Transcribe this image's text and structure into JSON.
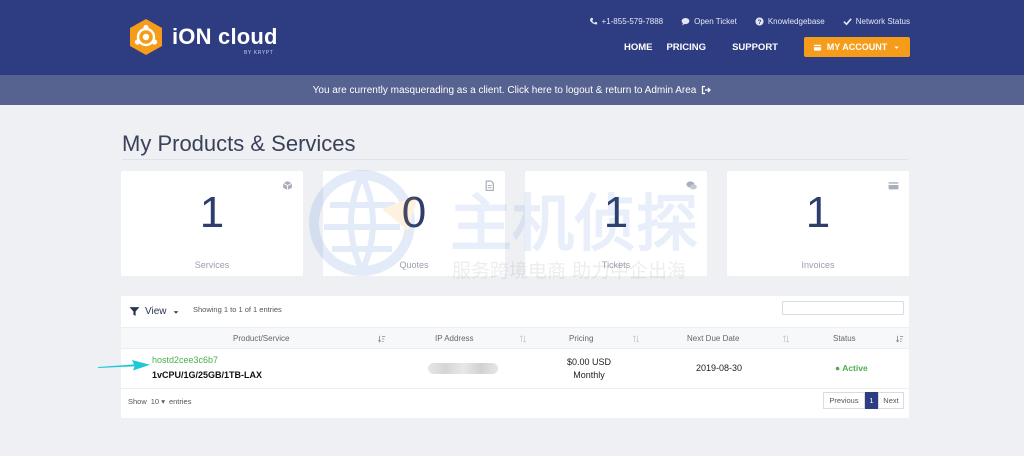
{
  "brand": {
    "name": "iON cloud",
    "sub": "BY KRYPT"
  },
  "top_links": {
    "phone": "+1-855-579-7888",
    "ticket": "Open Ticket",
    "kb": "Knowledgebase",
    "network": "Network Status"
  },
  "nav": {
    "home": "HOME",
    "pricing": "PRICING",
    "support": "SUPPORT",
    "account": "MY ACCOUNT"
  },
  "masquerade": {
    "text": "You are currently masquerading as a client. Click here to logout & return to Admin Area"
  },
  "page": {
    "title": "My Products & Services"
  },
  "tiles": [
    {
      "value": "1",
      "label": "Services",
      "icon": "cube-icon"
    },
    {
      "value": "0",
      "label": "Quotes",
      "icon": "document-icon"
    },
    {
      "value": "1",
      "label": "Tickets",
      "icon": "comments-icon"
    },
    {
      "value": "1",
      "label": "Invoices",
      "icon": "credit-card-icon"
    }
  ],
  "table": {
    "view_label": "View",
    "showing": "Showing 1 to 1 of 1 entries",
    "columns": {
      "product": "Product/Service",
      "ip": "IP Address",
      "pricing": "Pricing",
      "due": "Next Due Date",
      "status": "Status"
    },
    "rows": [
      {
        "hostname": "hostd2cee3c6b7",
        "product": "1vCPU/1G/25GB/1TB-LAX",
        "price": "$0.00 USD",
        "cycle": "Monthly",
        "due": "2019-08-30",
        "status": "Active"
      }
    ],
    "show": "Show",
    "length": "10",
    "entries": "entries",
    "pager": {
      "prev": "Previous",
      "current": "1",
      "next": "Next"
    }
  },
  "watermark": {
    "title": "主机侦探",
    "subtitle": "服务跨境电商 助力中企出海"
  },
  "colors": {
    "header": "#2e3d82",
    "masquerade": "#56628f",
    "accent": "#f59c1a",
    "active": "#4caf50",
    "arrow": "#1fc8d6"
  }
}
